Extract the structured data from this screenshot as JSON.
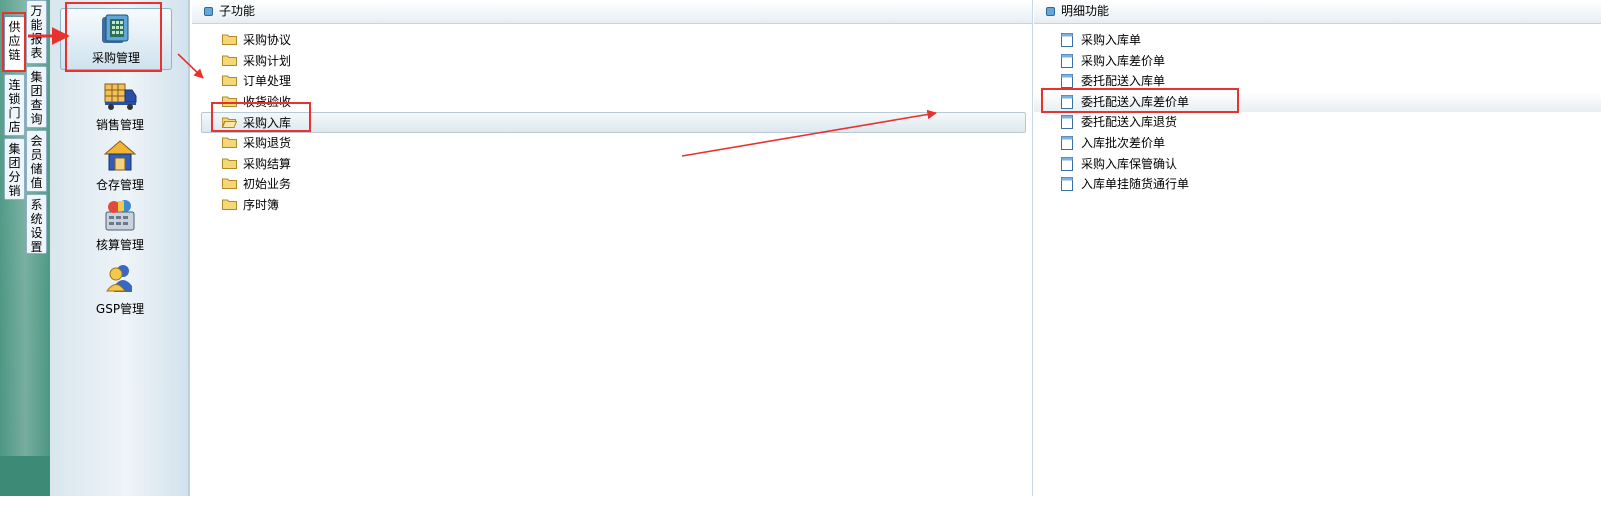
{
  "tabs": {
    "supply_chain": "供应链",
    "chain_store": "连锁门店",
    "group_distribution": "集团分销",
    "reports": "万能报表",
    "group_query": "集团查询",
    "member_value": "会员储值",
    "system_settings": "系统设置"
  },
  "modules": {
    "purchase": "采购管理",
    "sales": "销售管理",
    "stock": "仓存管理",
    "accounting": "核算管理",
    "gsp": "GSP管理"
  },
  "sub_panel": {
    "title": "子功能",
    "items": [
      "采购协议",
      "采购计划",
      "订单处理",
      "收货验收",
      "采购入库",
      "采购退货",
      "采购结算",
      "初始业务",
      "序时簿"
    ],
    "selected": "采购入库"
  },
  "detail_panel": {
    "title": "明细功能",
    "items": [
      "采购入库单",
      "采购入库差价单",
      "委托配送入库单",
      "委托配送入库差价单",
      "委托配送入库退货",
      "入库批次差价单",
      "采购入库保管确认",
      "入库单挂随货通行单"
    ],
    "highlighted": "委托配送入库差价单"
  },
  "icons": {
    "folder": "folder-icon",
    "folder_open": "folder-open-icon",
    "document": "document-icon",
    "phone_calc": "purchase-icon",
    "truck": "truck-icon",
    "house": "warehouse-icon",
    "calc": "calculator-icon",
    "people": "people-icon"
  },
  "colors": {
    "annotation_red": "#e8322f",
    "tabstrip_green": "#3f8f7a",
    "header_dot": "#6aa5d4"
  }
}
